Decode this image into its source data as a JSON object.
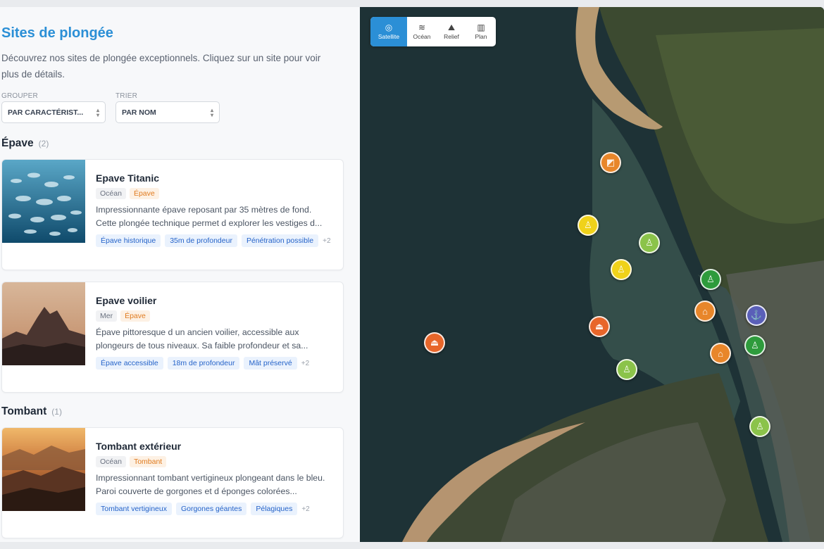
{
  "sidebar": {
    "title": "Sites de plongée",
    "intro": "Découvrez nos sites de plongée exceptionnels. Cliquez sur un site pour voir plus de détails.",
    "group_label": "GROUPER",
    "group_value": "PAR CARACTÉRIST...",
    "sort_label": "TRIER",
    "sort_value": "PAR NOM"
  },
  "groups": [
    {
      "name": "Épave",
      "count": "(2)",
      "sites": [
        {
          "title": "Epave Titanic",
          "env": "Océan",
          "type": "Épave",
          "desc": "Impressionnante épave reposant par 35 mètres de fond. Cette plongée technique permet d explorer les vestiges d...",
          "tags": [
            "Épave historique",
            "35m de profondeur",
            "Pénétration possible"
          ],
          "more": "+2"
        },
        {
          "title": "Epave voilier",
          "env": "Mer",
          "type": "Épave",
          "desc": "Épave pittoresque d un ancien voilier, accessible aux plongeurs de tous niveaux. Sa faible profondeur et sa...",
          "tags": [
            "Épave accessible",
            "18m de profondeur",
            "Mât préservé"
          ],
          "more": "+2"
        }
      ]
    },
    {
      "name": "Tombant",
      "count": "(1)",
      "sites": [
        {
          "title": "Tombant extérieur",
          "env": "Océan",
          "type": "Tombant",
          "desc": "Impressionnant tombant vertigineux plongeant dans le bleu. Paroi couverte de gorgones et d éponges colorées...",
          "tags": [
            "Tombant vertigineux",
            "Gorgones géantes",
            "Pélagiques"
          ],
          "more": "+2"
        }
      ]
    }
  ],
  "map": {
    "layers": [
      {
        "label": "Satellite",
        "icon": "globe-icon",
        "active": true
      },
      {
        "label": "Océan",
        "icon": "waves-icon",
        "active": false
      },
      {
        "label": "Relief",
        "icon": "mountain-icon",
        "active": false
      },
      {
        "label": "Plan",
        "icon": "map-icon",
        "active": false
      }
    ],
    "markers": [
      {
        "icon": "wreck-icon",
        "color": "#e8862a"
      },
      {
        "icon": "diver-icon",
        "color": "#f0d21a"
      },
      {
        "icon": "diver-icon",
        "color": "#8bc34a"
      },
      {
        "icon": "diver-icon",
        "color": "#f0d21a"
      },
      {
        "icon": "diver-icon",
        "color": "#2e9b3c"
      },
      {
        "icon": "boat-icon",
        "color": "#e8862a"
      },
      {
        "icon": "anchor-icon",
        "color": "#5a5fb8"
      },
      {
        "icon": "boat-icon",
        "color": "#e8662a"
      },
      {
        "icon": "boat-icon",
        "color": "#e8662a"
      },
      {
        "icon": "boat-icon",
        "color": "#e8862a"
      },
      {
        "icon": "diver-icon",
        "color": "#2e9b3c"
      },
      {
        "icon": "diver-icon",
        "color": "#8bc34a"
      },
      {
        "icon": "diver-icon",
        "color": "#8bc34a"
      }
    ]
  },
  "colors": {
    "accent": "#2b8fd6",
    "type_badge": "#e07b1f",
    "tag": "#2563c9"
  }
}
